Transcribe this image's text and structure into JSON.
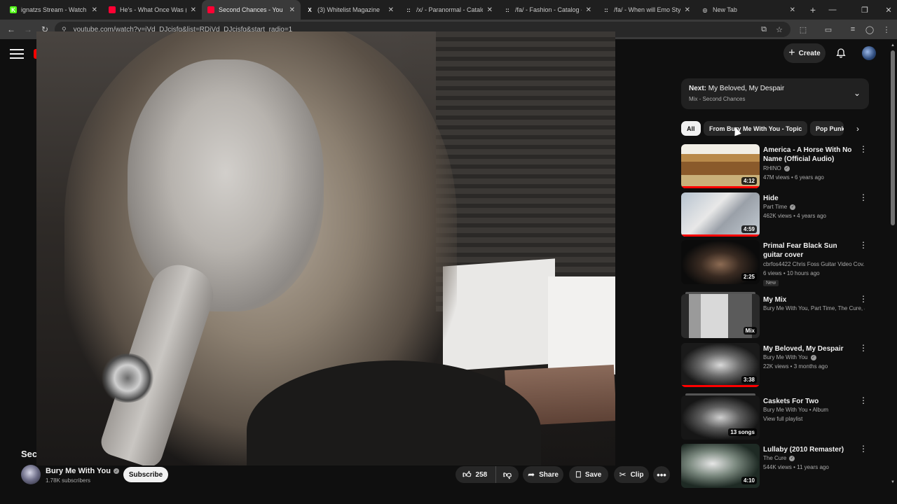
{
  "browser": {
    "tabs": [
      {
        "title": "ignatzs Stream - Watch Li",
        "favicon": "K",
        "fav_color": "#53fc18",
        "active": false
      },
      {
        "title": "He's - What Once Was (C",
        "favicon": "",
        "fav_color": "#ff0033",
        "active": false
      },
      {
        "title": "Second Chances - You",
        "favicon": "",
        "fav_color": "#ff0033",
        "active": true
      },
      {
        "title": "(3) Whitelist Magazine",
        "favicon": "X",
        "fav_color": "#1f1f1f",
        "active": false
      },
      {
        "title": "/x/ - Paranormal - Catalog",
        "favicon": "::",
        "fav_color": "#1f1f1f",
        "active": false
      },
      {
        "title": "/fa/ - Fashion - Catalog - /",
        "favicon": "::",
        "fav_color": "#1f1f1f",
        "active": false
      },
      {
        "title": "/fa/ - When will Emo Style",
        "favicon": "::",
        "fav_color": "#1f1f1f",
        "active": false
      },
      {
        "title": "New Tab",
        "favicon": "◎",
        "fav_color": "#1f1f1f",
        "active": false
      }
    ],
    "url": "youtube.com/watch?v=iVd_DJcisfg&list=RDiVd_DJcisfg&start_radio=1"
  },
  "header": {
    "create_label": "Create"
  },
  "video": {
    "title_visible": "Sec",
    "channel_name": "Bury Me With You",
    "subscribers": "1.78K subscribers",
    "subscribe_label": "Subscribe",
    "likes": "258",
    "share_label": "Share",
    "save_label": "Save",
    "clip_label": "Clip"
  },
  "up_next": {
    "prefix": "Next:",
    "title": "My Beloved, My Despair",
    "subtitle": "Mix - Second Chances"
  },
  "chips": [
    "All",
    "From Bury Me With You - Topic",
    "Pop Punk"
  ],
  "recommendations": [
    {
      "title": "America - A Horse With No Name (Official Audio)",
      "channel": "RHINO",
      "verified": true,
      "meta": "47M views • 6 years ago",
      "duration": "4:12",
      "badge": "",
      "progress": 1.0,
      "thumb": "america"
    },
    {
      "title": "Hide",
      "channel": "Part Time",
      "verified": true,
      "meta": "462K views • 4 years ago",
      "duration": "4:59",
      "badge": "",
      "progress": 1.0,
      "thumb": "hide"
    },
    {
      "title": "Primal Fear Black Sun guitar cover",
      "channel": "cbrfos4422 Chris Foss Guitar Video Cov...",
      "verified": false,
      "meta": "6 views • 10 hours ago",
      "duration": "2:25",
      "badge": "New",
      "progress": 0,
      "thumb": "primal"
    },
    {
      "title": "My Mix",
      "channel": "Bury Me With You, Part Time, The Cure, a...",
      "verified": false,
      "meta": "",
      "duration": "Mix",
      "badge": "",
      "progress": 0,
      "thumb": "mix"
    },
    {
      "title": "My Beloved, My Despair",
      "channel": "Bury Me With You",
      "verified": true,
      "meta": "22K views • 3 months ago",
      "duration": "3:38",
      "badge": "",
      "progress": 1.0,
      "thumb": "beloved"
    },
    {
      "title": "Caskets For Two",
      "channel": "Bury Me With You • Album",
      "verified": false,
      "meta": "View full playlist",
      "duration": "13 songs",
      "badge": "",
      "progress": 0,
      "thumb": "caskets"
    },
    {
      "title": "Lullaby (2010 Remaster)",
      "channel": "The Cure",
      "verified": true,
      "meta": "544K views • 11 years ago",
      "duration": "4:10",
      "badge": "",
      "progress": 0,
      "thumb": "lullaby"
    }
  ]
}
